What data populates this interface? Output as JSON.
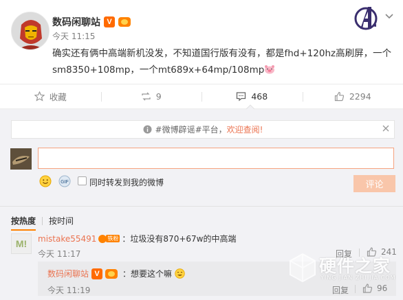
{
  "post": {
    "author": "数码闲聊站",
    "time": "今天 11:15",
    "text": "确实还有俩中高端新机没发，不知道国行版有没有，都是fhd+120hz高刷屏，一个sm8350+108mp，一个mt689x+64mp/108mp",
    "avatar_icon": "iron-man-avatar",
    "verified_badge": "V"
  },
  "actions": {
    "favorite_label": "收藏",
    "repost_count": "9",
    "comment_count": "468",
    "like_count": "2294"
  },
  "notice": {
    "prefix": "#微博辟谣#平台，",
    "link": "欢迎查阅!"
  },
  "composer": {
    "input_value": "",
    "repost_label": "同时转发到我的微博",
    "submit_label": "评论"
  },
  "sort": {
    "hot_label": "按热度",
    "time_label": "按时间"
  },
  "comments": [
    {
      "user": "mistake55491",
      "badge_text": "铁粉",
      "avatar_text": "M!",
      "text": "：垃圾没有870+67w的中高端",
      "time": "今天 11:17",
      "reply_label": "回复",
      "likes": "241",
      "replies": [
        {
          "user": "数码闲聊站",
          "text": "：想要这个嘛",
          "time": "今天 11:19",
          "reply_label": "回复",
          "likes": "96"
        }
      ]
    }
  ],
  "watermark": {
    "title": "硬件之家",
    "subtitle": "YING JIAN ZHI JIA.COM"
  },
  "colors": {
    "accent_orange": "#ff8200",
    "link_color": "#eb7350",
    "submit_disabled": "#f9c6aa",
    "panel_bg": "#f2f2f5"
  }
}
